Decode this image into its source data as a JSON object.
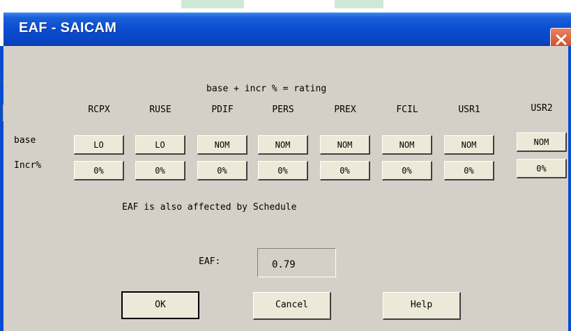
{
  "window": {
    "title": "EAF - SAICAM"
  },
  "heading": "base + incr % = rating",
  "columns": [
    "RCPX",
    "RUSE",
    "PDIF",
    "PERS",
    "PREX",
    "FCIL",
    "USR1",
    "USR2"
  ],
  "rows": [
    {
      "label": "base",
      "values": [
        "LO",
        "LO",
        "NOM",
        "NOM",
        "NOM",
        "NOM",
        "NOM",
        "NOM"
      ]
    },
    {
      "label": "Incr%",
      "values": [
        "0%",
        "0%",
        "0%",
        "0%",
        "0%",
        "0%",
        "0%",
        "0%"
      ]
    }
  ],
  "note": "EAF is also affected by Schedule",
  "eaf": {
    "label": "EAF:",
    "value": "0.79"
  },
  "buttons": {
    "ok": "OK",
    "cancel": "Cancel",
    "help": "Help"
  },
  "colors": {
    "titlebar": "#0a4cd0",
    "client": "#d4d0c8",
    "close": "#c9421d"
  }
}
